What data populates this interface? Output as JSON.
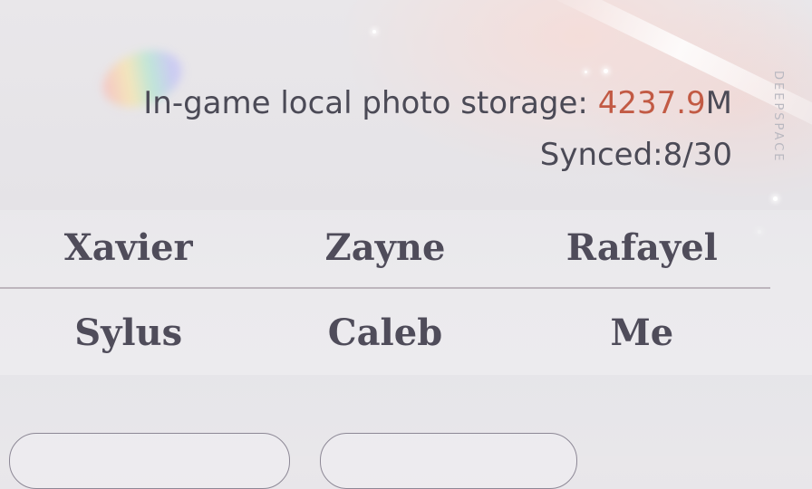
{
  "storage": {
    "label": "In-game local photo storage: ",
    "value": "4237.9",
    "unit": "M"
  },
  "sync": {
    "text": "Synced:8/30"
  },
  "watermark": "DEEPSPACE",
  "characters": [
    {
      "name": "Xavier"
    },
    {
      "name": "Zayne"
    },
    {
      "name": "Rafayel"
    },
    {
      "name": "Sylus"
    },
    {
      "name": "Caleb"
    },
    {
      "name": "Me"
    }
  ],
  "colors": {
    "storage_value": "#c25a44",
    "text": "#4b4a56",
    "divider": "#bdb6bd"
  }
}
